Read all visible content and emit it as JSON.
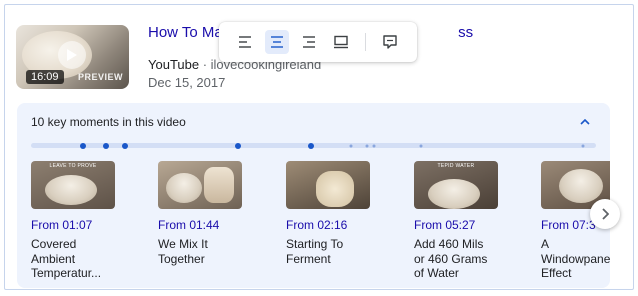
{
  "video": {
    "title": "How To Mal",
    "title_tail": "ss",
    "source": "YouTube",
    "source_sub": " · ilovecookingireland",
    "date": "Dec 15, 2017",
    "duration": "16:09",
    "preview_label": "PREVIEW"
  },
  "toolbar": {
    "buttons": [
      {
        "name": "align-left-icon",
        "active": false
      },
      {
        "name": "align-center-icon",
        "active": true
      },
      {
        "name": "align-right-icon",
        "active": false
      },
      {
        "name": "full-width-icon",
        "active": false
      },
      {
        "name": "comment-icon",
        "active": false
      }
    ]
  },
  "moments": {
    "heading": "10 key moments in this video",
    "cards": [
      {
        "time": "From 01:07",
        "label": "Covered\nAmbient\nTemperatur...",
        "caption": "LEAVE TO PROVE"
      },
      {
        "time": "From 01:44",
        "label": "We Mix It\nTogether",
        "caption": ""
      },
      {
        "time": "From 02:16",
        "label": "Starting To\nFerment",
        "caption": ""
      },
      {
        "time": "From 05:27",
        "label": "Add 460 Mils\nor 460 Grams\nof Water",
        "caption": "TEPID WATER"
      },
      {
        "time": "From 07:3",
        "label": "A\nWindowpane\nEffect",
        "caption": ""
      }
    ]
  },
  "colors": {
    "link": "#1a0dab",
    "panel": "#eef3fd",
    "accent": "#1a57c9"
  }
}
